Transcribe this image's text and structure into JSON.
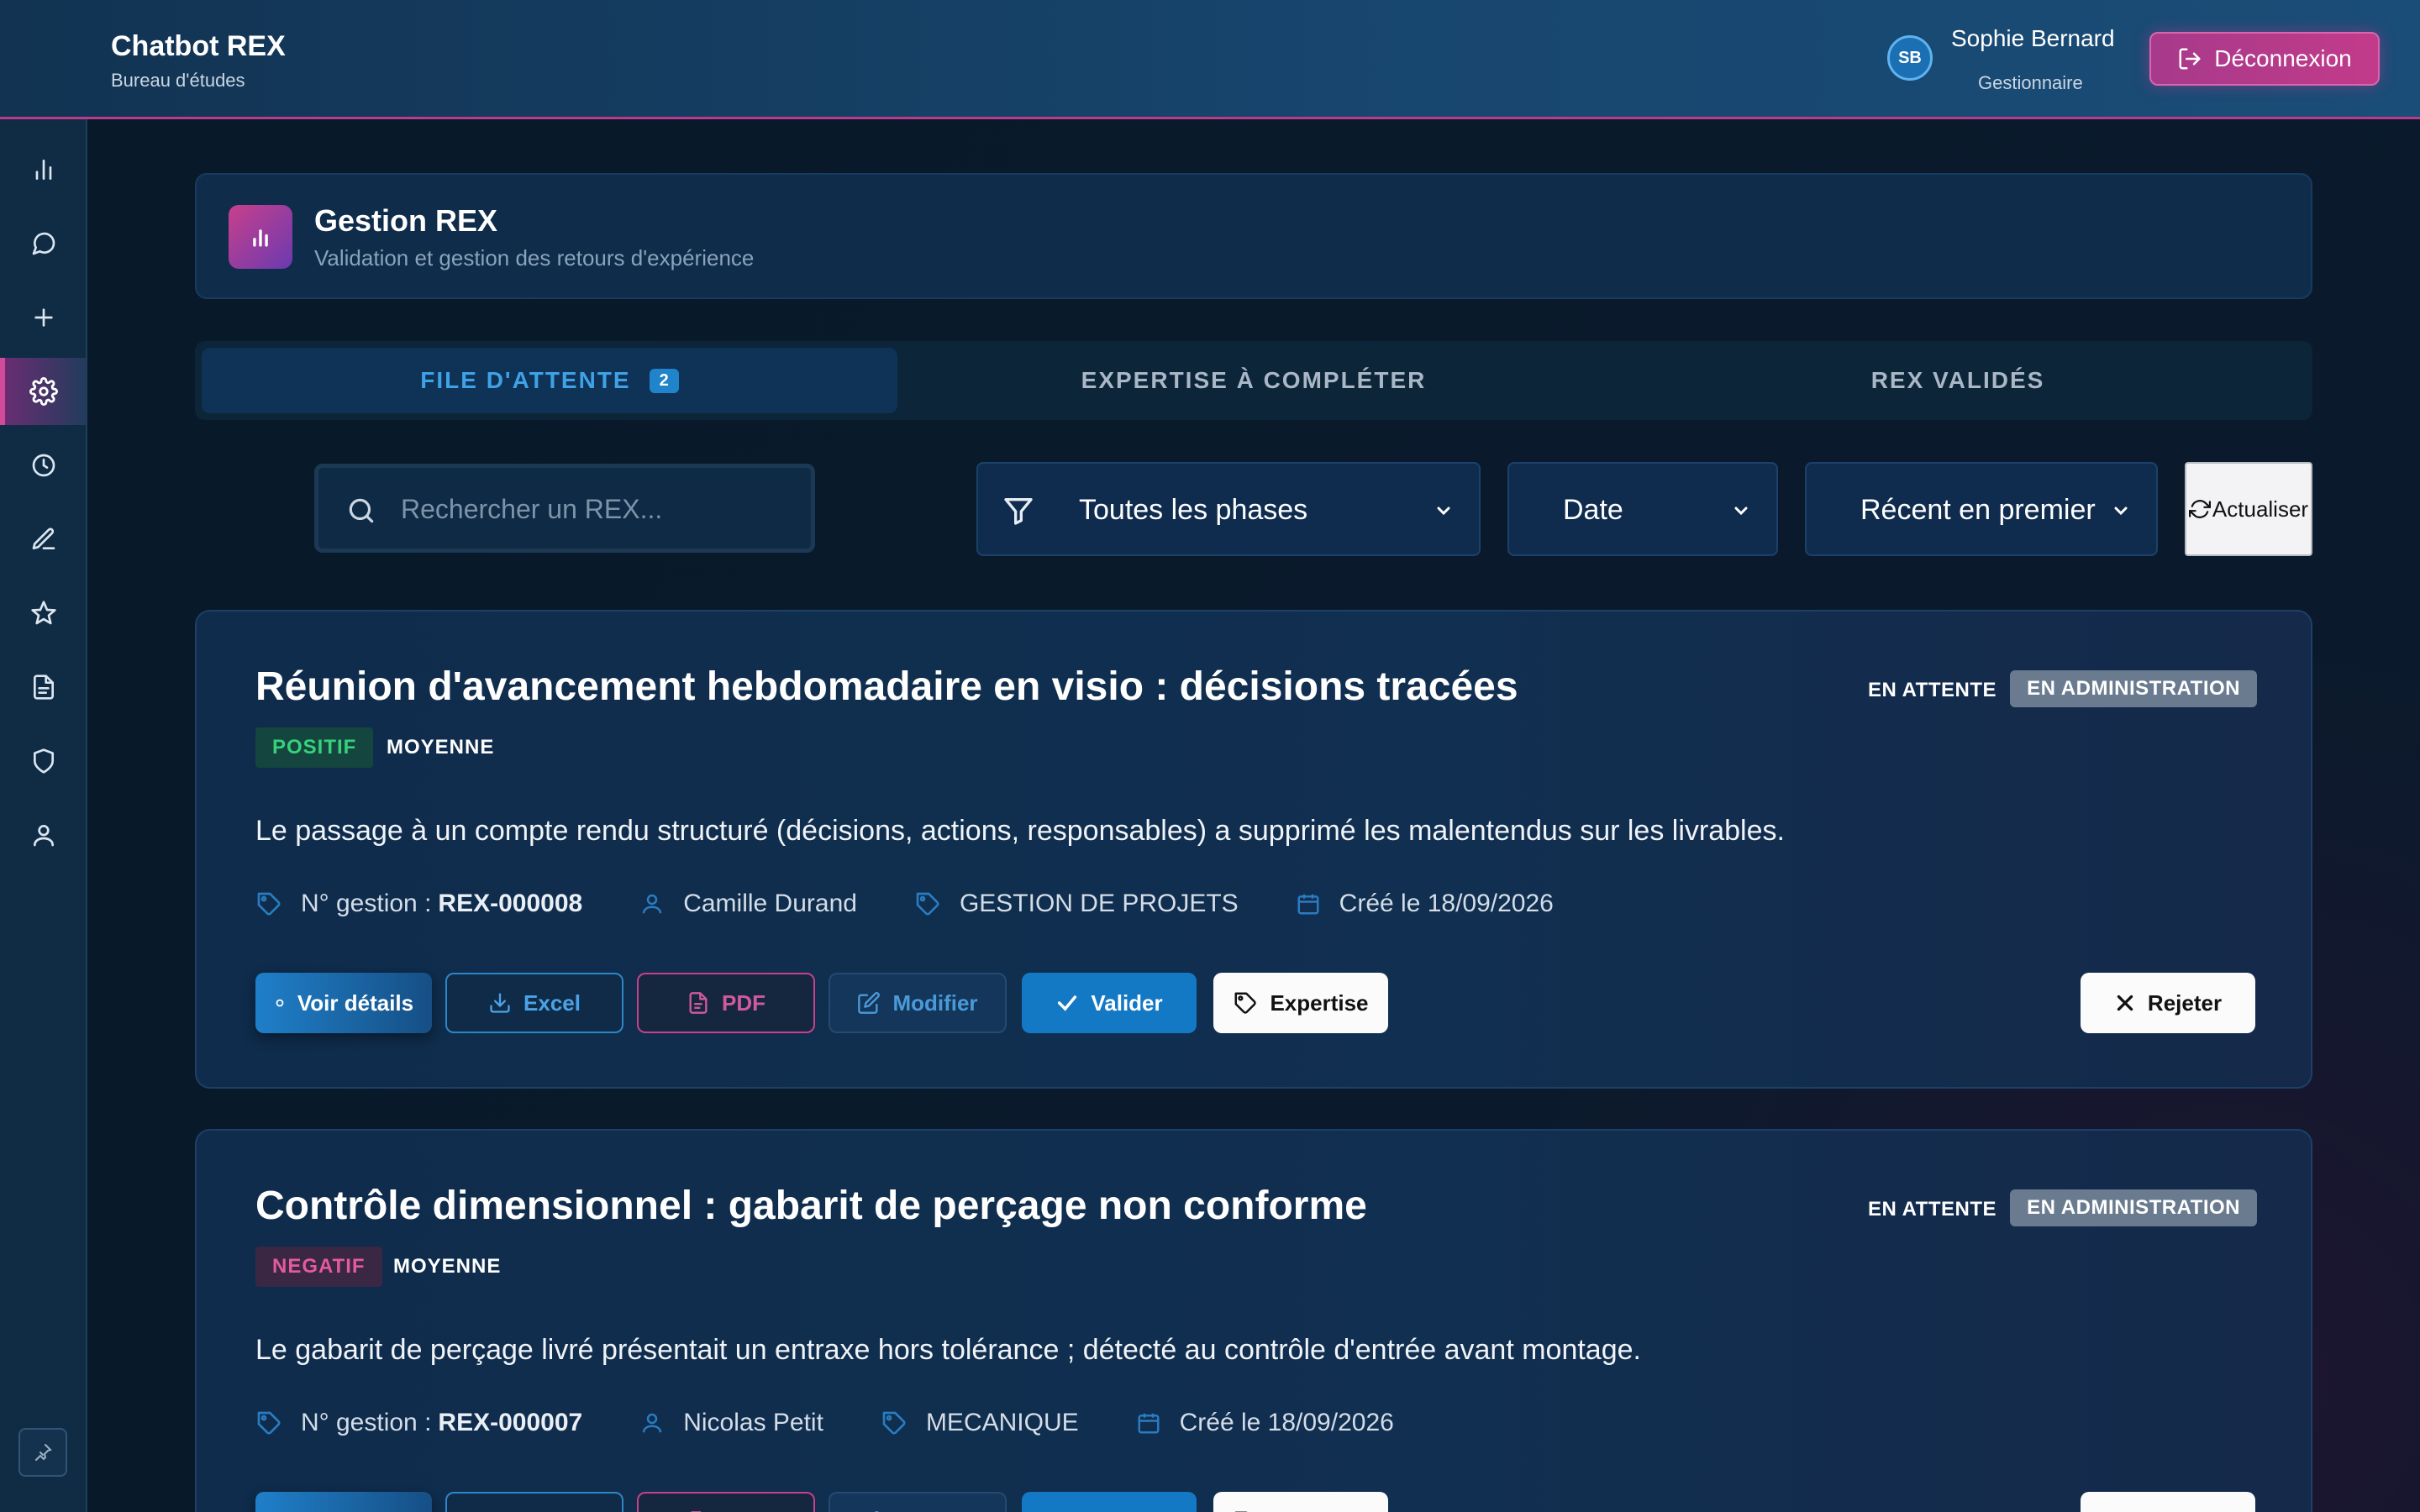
{
  "header": {
    "app_title": "Chatbot REX",
    "app_subtitle": "Bureau d'études",
    "user": {
      "initials": "SB",
      "name": "Sophie Bernard",
      "role": "Gestionnaire"
    },
    "logout_label": "Déconnexion"
  },
  "sidebar": {
    "items": [
      {
        "icon": "bar-chart-icon"
      },
      {
        "icon": "chat-icon"
      },
      {
        "icon": "plus-icon"
      },
      {
        "icon": "gear-icon",
        "active": true
      },
      {
        "icon": "clock-icon"
      },
      {
        "icon": "pen-icon"
      },
      {
        "icon": "star-icon"
      },
      {
        "icon": "document-icon"
      },
      {
        "icon": "shield-icon"
      },
      {
        "icon": "user-icon"
      }
    ],
    "pin_icon": "pin-icon"
  },
  "panel": {
    "title": "Gestion REX",
    "subtitle": "Validation et gestion des retours d'expérience"
  },
  "tabs": [
    {
      "label": "FILE D'ATTENTE",
      "count": "2",
      "active": true
    },
    {
      "label": "EXPERTISE À COMPLÉTER"
    },
    {
      "label": "REX VALIDÉS"
    }
  ],
  "filters": {
    "search_placeholder": "Rechercher un REX...",
    "phase": "Toutes les phases",
    "sort_field": "Date",
    "sort_order": "Récent en premier",
    "refresh_label": "Actualiser"
  },
  "cards": [
    {
      "title": "Réunion d'avancement hebdomadaire en visio : décisions tracées",
      "status": "EN ATTENTE",
      "stage": "EN ADMINISTRATION",
      "type": "POSITIF",
      "level": "MOYENNE",
      "description": "Le passage à un compte rendu structuré (décisions, actions, responsables) a supprimé les malentendus sur les livrables.",
      "ref_label": "N° gestion :",
      "ref": "REX-000008",
      "author": "Camille Durand",
      "domain": "GESTION DE PROJETS",
      "created": "Créé le 18/09/2026"
    },
    {
      "title": "Contrôle dimensionnel : gabarit de perçage non conforme",
      "status": "EN ATTENTE",
      "stage": "EN ADMINISTRATION",
      "type": "NEGATIF",
      "level": "MOYENNE",
      "description": "Le gabarit de perçage livré présentait un entraxe hors tolérance ; détecté au contrôle d'entrée avant montage.",
      "ref_label": "N° gestion :",
      "ref": "REX-000007",
      "author": "Nicolas Petit",
      "domain": "MECANIQUE",
      "created": "Créé le 18/09/2026"
    }
  ],
  "actions": {
    "view": "Voir détails",
    "excel": "Excel",
    "pdf": "PDF",
    "edit": "Modifier",
    "validate": "Valider",
    "expertise": "Expertise",
    "reject": "Rejeter"
  },
  "colors": {
    "accent_blue": "#1f84c9",
    "accent_pink": "#c23b8a",
    "positive": "#36d17a",
    "negative": "#e35a9d"
  }
}
